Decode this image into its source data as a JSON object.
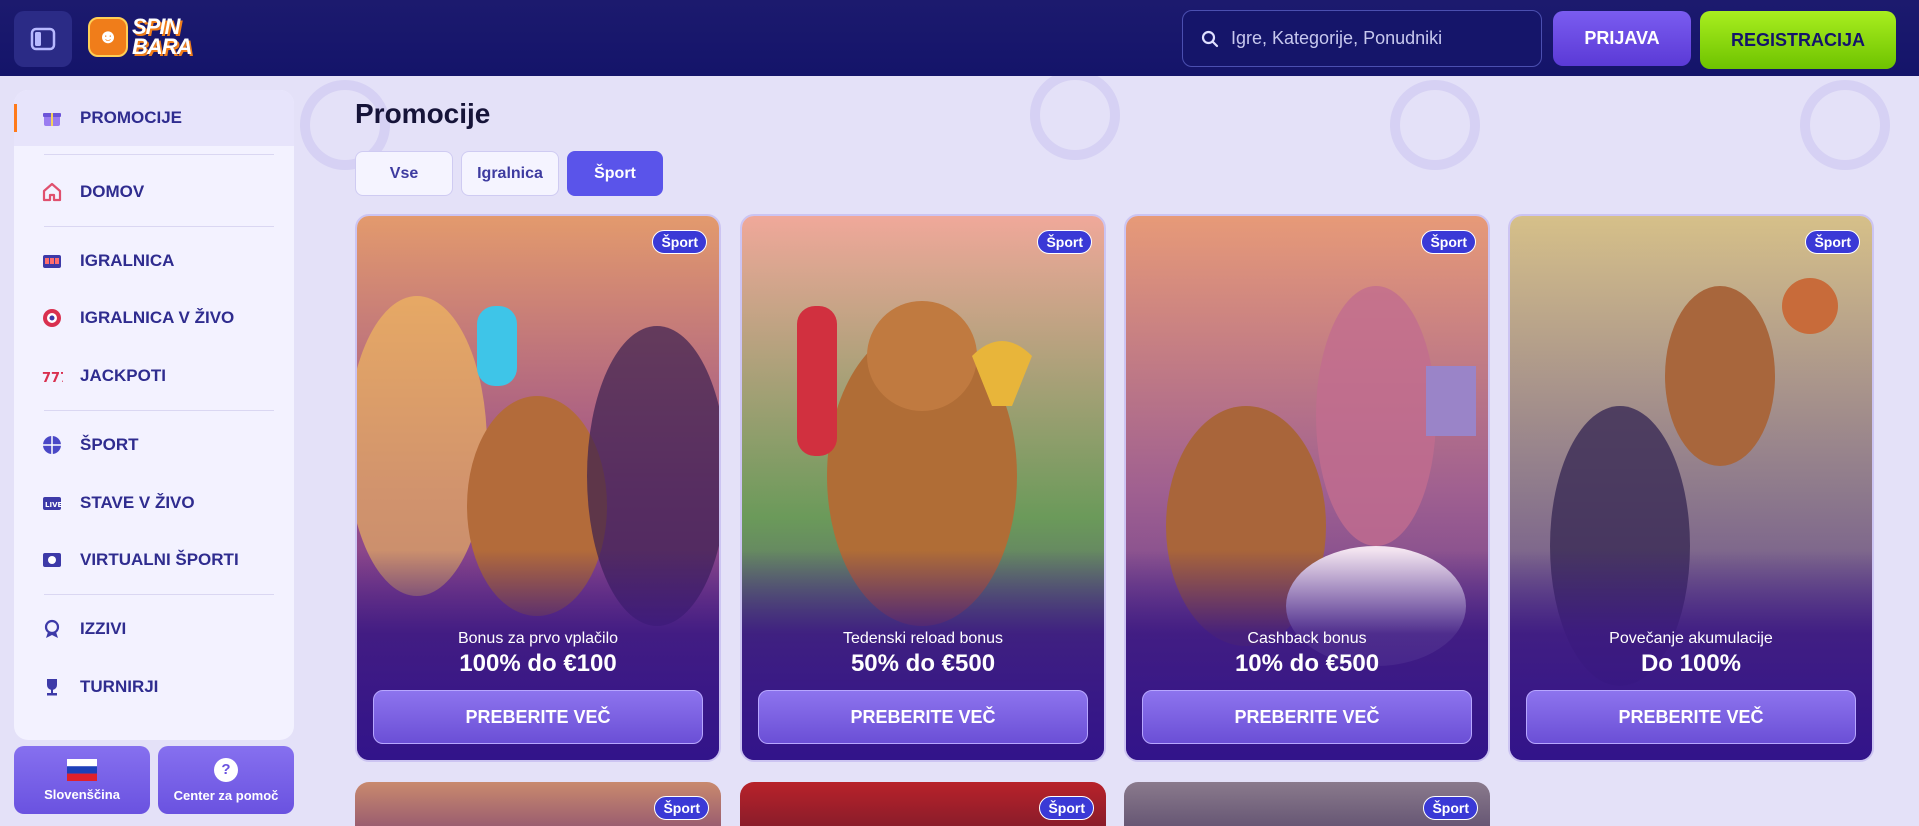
{
  "header": {
    "logo_line1": "SPIN",
    "logo_line2": "BARA",
    "search_placeholder": "Igre, Kategorije, Ponudniki",
    "login_label": "PRIJAVA",
    "register_label": "REGISTRACIJA"
  },
  "sidebar": {
    "items": [
      {
        "label": "PROMOCIJE",
        "icon": "gift-icon"
      },
      {
        "label": "DOMOV",
        "icon": "home-icon"
      },
      {
        "label": "IGRALNICA",
        "icon": "slot-machine-icon"
      },
      {
        "label": "IGRALNICA V ŽIVO",
        "icon": "roulette-chip-icon"
      },
      {
        "label": "JACKPOTI",
        "icon": "jackpot-777-icon"
      },
      {
        "label": "ŠPORT",
        "icon": "ball-icon"
      },
      {
        "label": "STAVE V ŽIVO",
        "icon": "live-tv-icon"
      },
      {
        "label": "VIRTUALNI ŠPORTI",
        "icon": "virtual-sports-icon"
      },
      {
        "label": "IZZIVI",
        "icon": "badge-icon"
      },
      {
        "label": "TURNIRJI",
        "icon": "trophy-icon"
      }
    ],
    "language_label": "Slovenščina",
    "help_label": "Center za pomoč",
    "help_glyph": "?"
  },
  "main": {
    "title": "Promocije",
    "filters": [
      "Vse",
      "Igralnica",
      "Šport"
    ],
    "active_filter": "Šport",
    "cards": [
      {
        "tag": "Šport",
        "subtitle": "Bonus za prvo vplačilo",
        "headline": "100% do €100",
        "cta": "PREBERITE VEČ"
      },
      {
        "tag": "Šport",
        "subtitle": "Tedenski reload bonus",
        "headline": "50% do €500",
        "cta": "PREBERITE VEČ"
      },
      {
        "tag": "Šport",
        "subtitle": "Cashback bonus",
        "headline": "10% do €500",
        "cta": "PREBERITE VEČ"
      },
      {
        "tag": "Šport",
        "subtitle": "Povečanje akumulacije",
        "headline": "Do 100%",
        "cta": "PREBERITE VEČ"
      }
    ],
    "peek_tags": [
      "Šport",
      "Šport",
      "Šport"
    ]
  },
  "colors": {
    "header_bg": "#1c1a6e",
    "accent_purple": "#5a54ea",
    "register_green": "#8fdc0f",
    "page_bg": "#e4e1f8"
  }
}
